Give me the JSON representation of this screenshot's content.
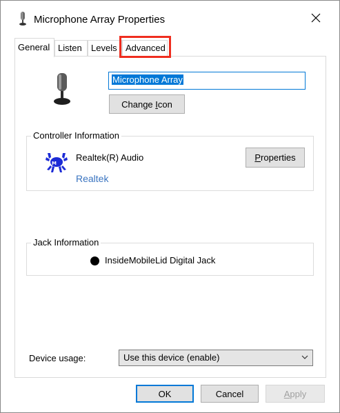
{
  "window": {
    "title": "Microphone Array Properties",
    "close_icon": "close-icon",
    "title_icon": "microphone-icon"
  },
  "tabs": [
    {
      "label": "General",
      "active": true
    },
    {
      "label": "Listen",
      "active": false
    },
    {
      "label": "Levels",
      "active": false
    },
    {
      "label": "Advanced",
      "active": false,
      "highlighted": true
    }
  ],
  "device": {
    "name_value": "Microphone Array",
    "change_icon_prefix": "Change ",
    "change_icon_accel": "I",
    "change_icon_suffix": "con"
  },
  "controller": {
    "group_label": "Controller Information",
    "name": "Realtek(R) Audio",
    "vendor_link": "Realtek",
    "properties_accel": "P",
    "properties_suffix": "roperties",
    "logo_icon": "realtek-crab-icon"
  },
  "jack": {
    "group_label": "Jack Information",
    "description": "InsideMobileLid Digital Jack",
    "color": "#000000"
  },
  "usage": {
    "label": "Device usage:",
    "selected": "Use this device (enable)"
  },
  "buttons": {
    "ok": "OK",
    "cancel": "Cancel",
    "apply_accel": "A",
    "apply_suffix": "pply"
  },
  "colors": {
    "accent": "#0078d7",
    "highlight_box": "#ef2d1f",
    "link": "#3a74c0"
  }
}
